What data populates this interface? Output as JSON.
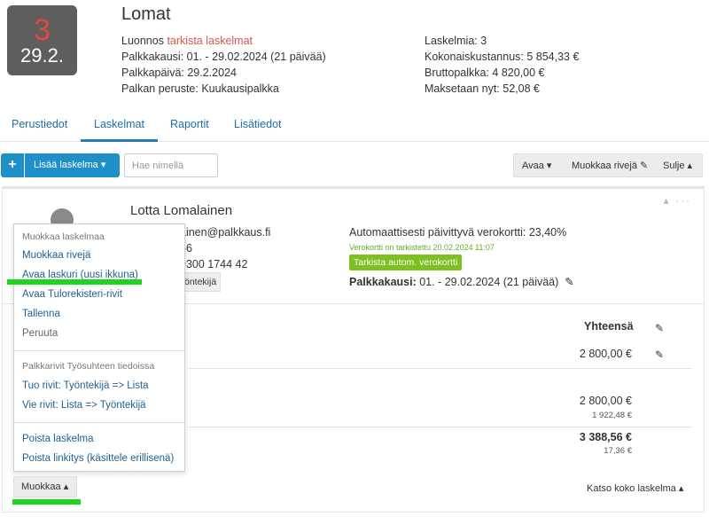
{
  "badge": {
    "number": "3",
    "date": "29.2."
  },
  "header": {
    "title": "Lomat",
    "status_prefix": "Luonnos",
    "status_link": "tarkista laskelmat",
    "pay_period": "Palkkakausi: 01. - 29.02.2024 (21 päivää)",
    "pay_day": "Palkkapäivä: 29.2.2024",
    "pay_basis": "Palkan peruste: Kuukausipalkka",
    "calc_count": "Laskelmia: 3",
    "total_cost": "Kokonaiskustannus: 5 854,33 €",
    "gross": "Bruttopalkka: 4 820,00 €",
    "paid_now": "Maksetaan nyt: 52,08 €"
  },
  "tabs": [
    {
      "label": "Perustiedot"
    },
    {
      "label": "Laskelmat"
    },
    {
      "label": "Raportit"
    },
    {
      "label": "Lisätiedot"
    }
  ],
  "toolbar": {
    "plus": "+",
    "add_label": "Lisää laskelma ▾",
    "search_placeholder": "Hae nimellä",
    "open": "Avaa ▾",
    "edit_rows": "Muokkaa rivejä ✎",
    "close": "Sulje ▴"
  },
  "employee": {
    "name": "Lotta Lomalainen",
    "email_partial": "ainen@palkkaus.fi",
    "line2_partial": "56",
    "phone_partial": "9300 1744 42",
    "role_partial": "öntekijä",
    "tax_card": "Automaattisesti päivittyvä verokortti: 23,40%",
    "tax_checked": "Verokortti on tarkistettu 20.02.2024 11:07",
    "tax_button": "Tarkista autom. verokortti",
    "period_label": "Palkkakausi:",
    "period_value": "01. - 29.02.2024 (21 päivää)",
    "card_controls": "▴ ···"
  },
  "totals": {
    "header": "Yhteensä",
    "row1": "2 800,00 €",
    "row2": "2 800,00 €",
    "row2_small": "1 922,48 €",
    "row3": "3 388,56 €",
    "row3_small": "17,36 €",
    "see_all": "Katso koko laskelma ▴"
  },
  "menu": {
    "section1_head": "Muokkaa laskelmaa",
    "items1": [
      "Muokkaa rivejä",
      "Avaa laskuri (uusi ikkuna)",
      "Avaa Tulorekisteri-rivit",
      "Tallenna",
      "Peruuta"
    ],
    "section2_head": "Palkkarivit Työsuhteen tiedoissa",
    "items2": [
      "Tuo rivit: Työntekijä => Lista",
      "Vie rivit: Lista => Työntekijä"
    ],
    "items3": [
      "Poista laskelma",
      "Poista linkitys (käsittele erillisenä)"
    ]
  },
  "edit_button": "Muokkaa ▴",
  "colors": {
    "accent": "#1f8fc9",
    "highlight": "#1fd41f",
    "tax_green": "#7dc021",
    "status_red": "#d9534f"
  }
}
